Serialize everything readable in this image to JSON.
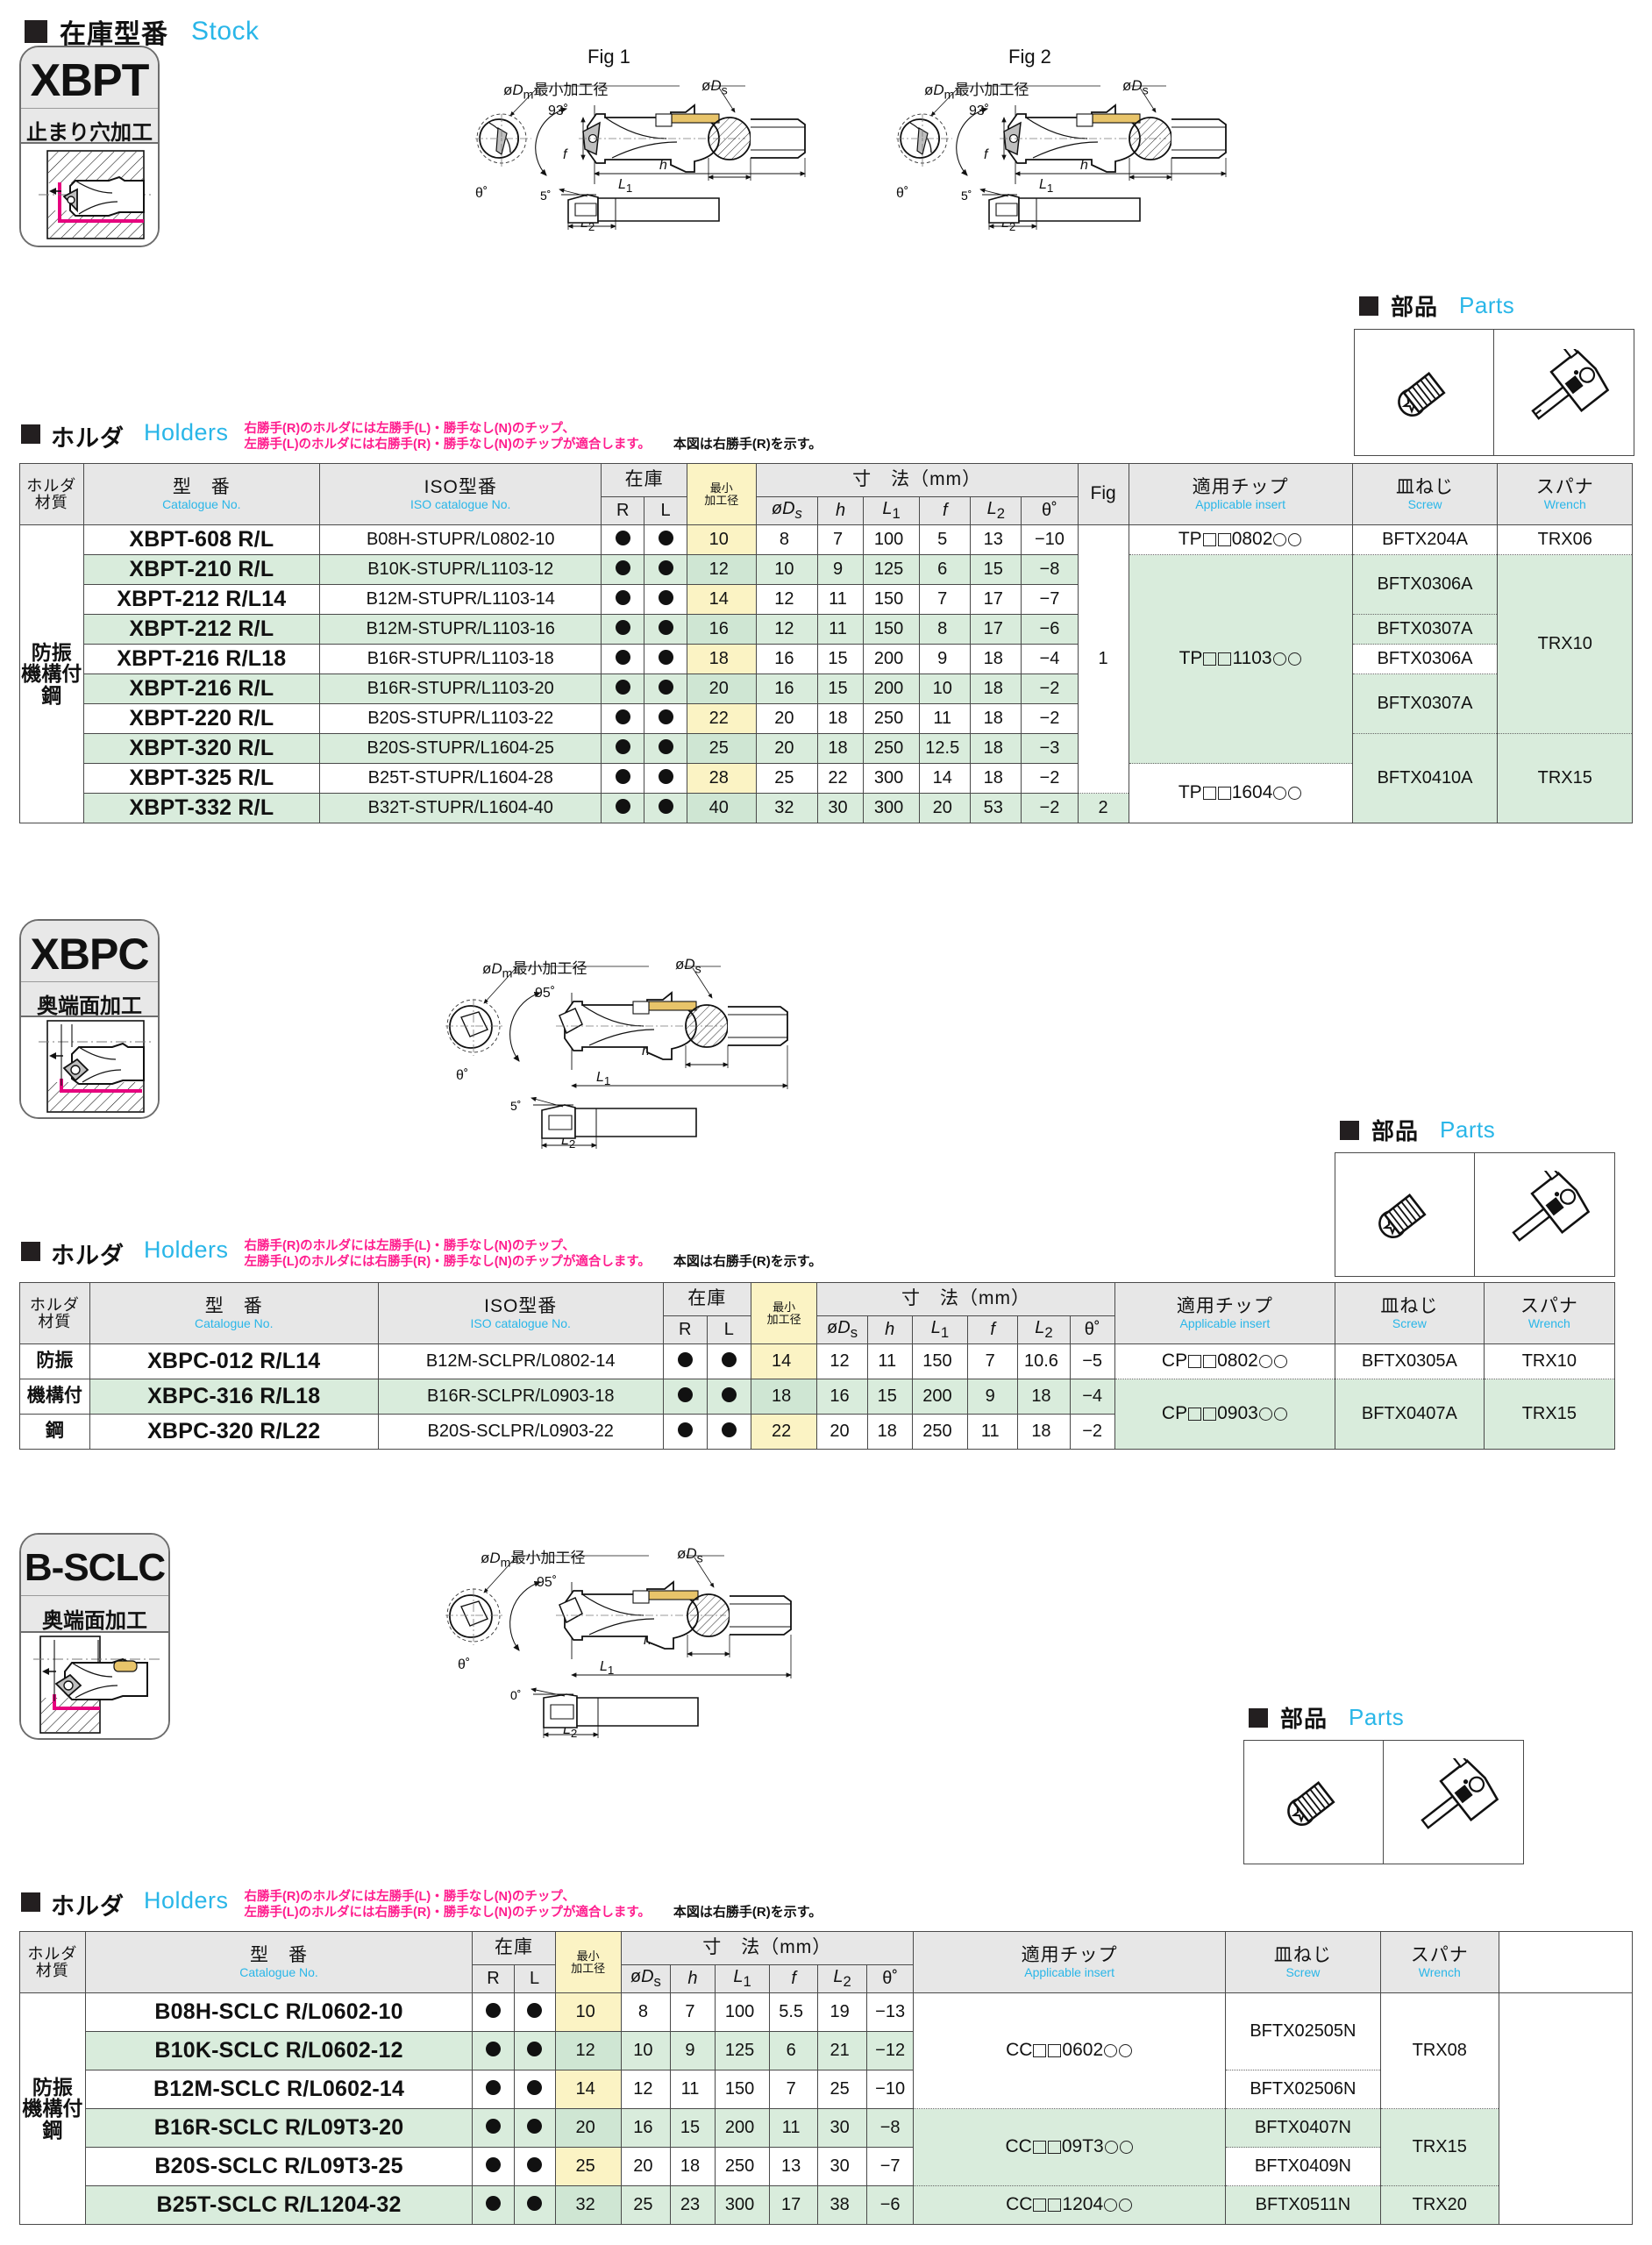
{
  "page": {
    "stock_heading_jp": "在庫型番",
    "stock_heading_en": "Stock"
  },
  "icons": {
    "screw": "screw-icon",
    "wrench": "wrench-icon",
    "black_square": "black-square-bullet-icon",
    "stock_dot": "filled-circle-icon"
  },
  "common": {
    "holders_jp": "ホルダ",
    "holders_en": "Holders",
    "note_line1": "右勝手(R)のホルダには左勝手(L)・勝手なし(N)のチップ、",
    "note_line2": "左勝手(L)のホルダには右勝手(R)・勝手なし(N)のチップが適合します。",
    "note_right": "本図は右勝手(R)を示す。",
    "parts_jp": "部品",
    "parts_en": "Parts",
    "colors": {
      "accent_cyan": "#29b6e8",
      "note_pink": "#ff1e8e",
      "stripe_green": "#d9ecdc",
      "min_dia_yellow": "#fbf3c4",
      "header_grey": "#e7e7e7"
    },
    "headers": {
      "material_jp_l1": "ホルダ",
      "material_jp_l2": "材質",
      "cat_jp": "型　番",
      "cat_en": "Catalogue No.",
      "iso_jp": "ISO型番",
      "iso_en": "ISO catalogue No.",
      "stock_jp": "在庫",
      "stock_r": "R",
      "stock_l": "L",
      "min_l1": "最小",
      "min_l2": "加工径",
      "dm": "øDm",
      "dims_jp": "寸　法（mm）",
      "ds": "øDs",
      "h": "h",
      "l1": "L1",
      "f": "f",
      "l2": "L2",
      "theta": "θ˚",
      "fig": "Fig",
      "insert_jp": "適用チップ",
      "insert_en": "Applicable insert",
      "screw_jp": "皿ねじ",
      "screw_en": "Screw",
      "wrench_jp": "スパナ",
      "wrench_en": "Wrench"
    }
  },
  "sections": [
    {
      "id": "xbpt",
      "badge_title": "XBPT",
      "badge_sub": "止まり穴加工",
      "material": "防振\n機構付\n鋼",
      "material_lines": [
        "防振",
        "機構付",
        "鋼"
      ],
      "figures": [
        {
          "name": "Fig 1",
          "angle": "93˚",
          "back_angle": "5˚",
          "labels": [
            "øDm最小加工径",
            "øDs",
            "L1",
            "L2",
            "h",
            "f",
            "θ˚"
          ]
        },
        {
          "name": "Fig 2",
          "angle": "93˚",
          "back_angle": "5˚",
          "labels": [
            "øDm最小加工径",
            "øDs",
            "L1",
            "L2",
            "h",
            "f",
            "θ˚"
          ]
        }
      ],
      "rows": [
        {
          "cat": "XBPT-608 R/L",
          "iso": "B08H-STUPR/L0802-10",
          "r": "●",
          "l": "●",
          "dm": "10",
          "ds": "8",
          "h": "7",
          "L1": "100",
          "f": "5",
          "L2": "13",
          "th": "−10"
        },
        {
          "cat": "XBPT-210 R/L",
          "iso": "B10K-STUPR/L1103-12",
          "r": "●",
          "l": "●",
          "dm": "12",
          "ds": "10",
          "h": "9",
          "L1": "125",
          "f": "6",
          "L2": "15",
          "th": "−8"
        },
        {
          "cat": "XBPT-212 R/L14",
          "iso": "B12M-STUPR/L1103-14",
          "r": "●",
          "l": "●",
          "dm": "14",
          "ds": "12",
          "h": "11",
          "L1": "150",
          "f": "7",
          "L2": "17",
          "th": "−7"
        },
        {
          "cat": "XBPT-212 R/L",
          "iso": "B12M-STUPR/L1103-16",
          "r": "●",
          "l": "●",
          "dm": "16",
          "ds": "12",
          "h": "11",
          "L1": "150",
          "f": "8",
          "L2": "17",
          "th": "−6"
        },
        {
          "cat": "XBPT-216 R/L18",
          "iso": "B16R-STUPR/L1103-18",
          "r": "●",
          "l": "●",
          "dm": "18",
          "ds": "16",
          "h": "15",
          "L1": "200",
          "f": "9",
          "L2": "18",
          "th": "−4"
        },
        {
          "cat": "XBPT-216 R/L",
          "iso": "B16R-STUPR/L1103-20",
          "r": "●",
          "l": "●",
          "dm": "20",
          "ds": "16",
          "h": "15",
          "L1": "200",
          "f": "10",
          "L2": "18",
          "th": "−2"
        },
        {
          "cat": "XBPT-220 R/L",
          "iso": "B20S-STUPR/L1103-22",
          "r": "●",
          "l": "●",
          "dm": "22",
          "ds": "20",
          "h": "18",
          "L1": "250",
          "f": "11",
          "L2": "18",
          "th": "−2"
        },
        {
          "cat": "XBPT-320 R/L",
          "iso": "B20S-STUPR/L1604-25",
          "r": "●",
          "l": "●",
          "dm": "25",
          "ds": "20",
          "h": "18",
          "L1": "250",
          "f": "12.5",
          "L2": "18",
          "th": "−3"
        },
        {
          "cat": "XBPT-325 R/L",
          "iso": "B25T-STUPR/L1604-28",
          "r": "●",
          "l": "●",
          "dm": "28",
          "ds": "25",
          "h": "22",
          "L1": "300",
          "f": "14",
          "L2": "18",
          "th": "−2"
        },
        {
          "cat": "XBPT-332 R/L",
          "iso": "B32T-STUPR/L1604-40",
          "r": "●",
          "l": "●",
          "dm": "40",
          "ds": "32",
          "h": "30",
          "L1": "300",
          "f": "20",
          "L2": "53",
          "th": "−2"
        }
      ],
      "fig_groups": [
        {
          "value": "1",
          "span": 9
        },
        {
          "value": "2",
          "span": 1
        }
      ],
      "insert_groups": [
        {
          "prefix": "TP",
          "size": "0802",
          "span": 1
        },
        {
          "prefix": "TP",
          "size": "1103",
          "span": 7
        },
        {
          "prefix": "TP",
          "size": "1604",
          "span": 2
        }
      ],
      "screw_groups": [
        {
          "value": "BFTX204A",
          "span": 1
        },
        {
          "value": "BFTX0306A",
          "span": 2
        },
        {
          "value": "BFTX0307A",
          "span": 1
        },
        {
          "value": "BFTX0306A",
          "span": 1
        },
        {
          "value": "BFTX0307A",
          "span": 2
        },
        {
          "value": "BFTX0410A",
          "span": 3
        }
      ],
      "wrench_groups": [
        {
          "value": "TRX06",
          "span": 1
        },
        {
          "value": "TRX10",
          "span": 6
        },
        {
          "value": "TRX15",
          "span": 3
        }
      ]
    },
    {
      "id": "xbpc",
      "badge_title": "XBPC",
      "badge_sub": "奥端面加工",
      "material_lines": [
        "防振",
        "機構付",
        "鋼"
      ],
      "figures": [
        {
          "name": "",
          "angle": "95˚",
          "back_angle": "5˚",
          "labels": [
            "øDm最小加工径",
            "øDs",
            "L1",
            "L2",
            "h",
            "θ˚"
          ]
        }
      ],
      "rows": [
        {
          "mat": "防振",
          "cat": "XBPC-012 R/L14",
          "iso": "B12M-SCLPR/L0802-14",
          "r": "●",
          "l": "●",
          "dm": "14",
          "ds": "12",
          "h": "11",
          "L1": "150",
          "f": "7",
          "L2": "10.6",
          "th": "−5"
        },
        {
          "mat": "機構付",
          "cat": "XBPC-316 R/L18",
          "iso": "B16R-SCLPR/L0903-18",
          "r": "●",
          "l": "●",
          "dm": "18",
          "ds": "16",
          "h": "15",
          "L1": "200",
          "f": "9",
          "L2": "18",
          "th": "−4"
        },
        {
          "mat": "鋼",
          "cat": "XBPC-320 R/L22",
          "iso": "B20S-SCLPR/L0903-22",
          "r": "●",
          "l": "●",
          "dm": "22",
          "ds": "20",
          "h": "18",
          "L1": "250",
          "f": "11",
          "L2": "18",
          "th": "−2"
        }
      ],
      "insert_groups": [
        {
          "prefix": "CP",
          "size": "0802",
          "span": 1
        },
        {
          "prefix": "CP",
          "size": "0903",
          "span": 2
        }
      ],
      "screw_groups": [
        {
          "value": "BFTX0305A",
          "span": 1
        },
        {
          "value": "BFTX0407A",
          "span": 2
        }
      ],
      "wrench_groups": [
        {
          "value": "TRX10",
          "span": 1
        },
        {
          "value": "TRX15",
          "span": 2
        }
      ]
    },
    {
      "id": "bsclc",
      "badge_title": "B-SCLC",
      "badge_sub": "奥端面加工",
      "material_lines": [
        "防振",
        "機構付",
        "鋼"
      ],
      "figures": [
        {
          "name": "",
          "angle": "95˚",
          "back_angle": "0˚",
          "labels": [
            "øDm最小加工径",
            "øDs",
            "L1",
            "L2",
            "h",
            "θ˚"
          ]
        }
      ],
      "rows": [
        {
          "cat": "B08H-SCLC R/L0602-10",
          "r": "●",
          "l": "●",
          "dm": "10",
          "ds": "8",
          "h": "7",
          "L1": "100",
          "f": "5.5",
          "L2": "19",
          "th": "−13"
        },
        {
          "cat": "B10K-SCLC R/L0602-12",
          "r": "●",
          "l": "●",
          "dm": "12",
          "ds": "10",
          "h": "9",
          "L1": "125",
          "f": "6",
          "L2": "21",
          "th": "−12"
        },
        {
          "cat": "B12M-SCLC R/L0602-14",
          "r": "●",
          "l": "●",
          "dm": "14",
          "ds": "12",
          "h": "11",
          "L1": "150",
          "f": "7",
          "L2": "25",
          "th": "−10"
        },
        {
          "cat": "B16R-SCLC R/L09T3-20",
          "r": "●",
          "l": "●",
          "dm": "20",
          "ds": "16",
          "h": "15",
          "L1": "200",
          "f": "11",
          "L2": "30",
          "th": "−8"
        },
        {
          "cat": "B20S-SCLC R/L09T3-25",
          "r": "●",
          "l": "●",
          "dm": "25",
          "ds": "20",
          "h": "18",
          "L1": "250",
          "f": "13",
          "L2": "30",
          "th": "−7"
        },
        {
          "cat": "B25T-SCLC R/L1204-32",
          "r": "●",
          "l": "●",
          "dm": "32",
          "ds": "25",
          "h": "23",
          "L1": "300",
          "f": "17",
          "L2": "38",
          "th": "−6"
        }
      ],
      "insert_groups": [
        {
          "prefix": "CC",
          "size": "0602",
          "span": 3
        },
        {
          "prefix": "CC",
          "size": "09T3",
          "span": 2
        },
        {
          "prefix": "CC",
          "size": "1204",
          "span": 1
        }
      ],
      "screw_groups": [
        {
          "value": "BFTX02505N",
          "span": 2
        },
        {
          "value": "BFTX02506N",
          "span": 1
        },
        {
          "value": "BFTX0407N",
          "span": 1
        },
        {
          "value": "BFTX0409N",
          "span": 1
        },
        {
          "value": "BFTX0511N",
          "span": 1
        }
      ],
      "wrench_groups": [
        {
          "value": "TRX08",
          "span": 3
        },
        {
          "value": "TRX15",
          "span": 2
        },
        {
          "value": "TRX20",
          "span": 1
        }
      ]
    }
  ]
}
